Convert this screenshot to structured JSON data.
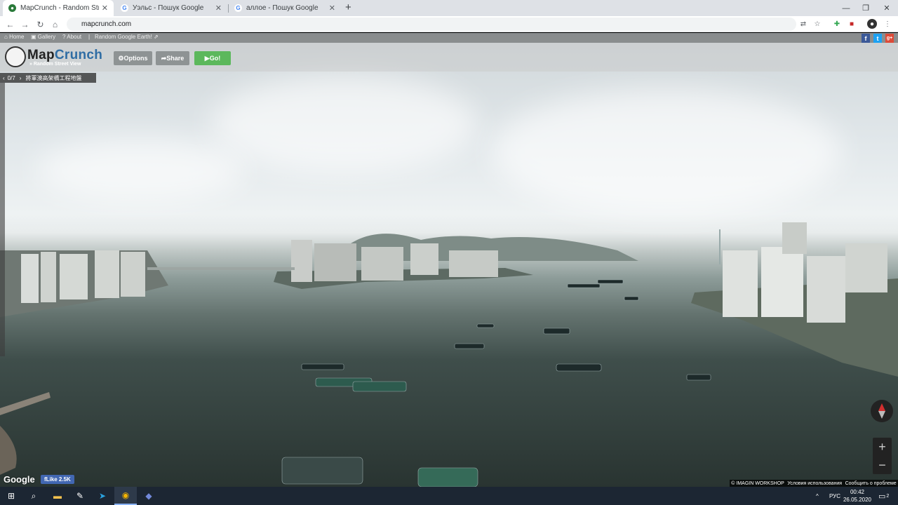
{
  "browser": {
    "tabs": [
      {
        "title": "MapCrunch - Random Street View",
        "favicon": "mapcrunch-favicon",
        "active": true
      },
      {
        "title": "Уэльс - Пошук Google",
        "favicon": "google-favicon",
        "active": false
      },
      {
        "title": "аллое - Пошук Google",
        "favicon": "google-favicon",
        "active": false
      }
    ],
    "new_tab_label": "+",
    "url": "mapcrunch.com"
  },
  "mapcrunch": {
    "nav_links": {
      "home": "Home",
      "gallery": "Gallery",
      "about": "About",
      "random_google_earth": "Random Google Earth!"
    },
    "logo": {
      "part1": "Map",
      "part2": "Crunch",
      "tagline": "» Random Street View"
    },
    "buttons": {
      "options": "Options",
      "share": "Share",
      "go": "Go!"
    },
    "location": {
      "counter": "0/7",
      "place": "將軍澳高架橋工程地盤"
    }
  },
  "map": {
    "google_logo": "Google",
    "fb_like": "Like 2.5K",
    "credits": [
      "© IMAGIN WORKSHOP",
      "Условия использования",
      "Сообщить о проблеме"
    ],
    "zoom_in": "+",
    "zoom_out": "−"
  },
  "taskbar": {
    "language": "РУС",
    "time": "00:42",
    "date": "26.05.2020",
    "notifications": "2"
  },
  "colors": {
    "mapcrunch_blue": "#2f6da4",
    "go_green": "#5cb85c",
    "facebook": "#3b5998",
    "twitter": "#1da1f2",
    "gplus": "#dd4b39"
  }
}
